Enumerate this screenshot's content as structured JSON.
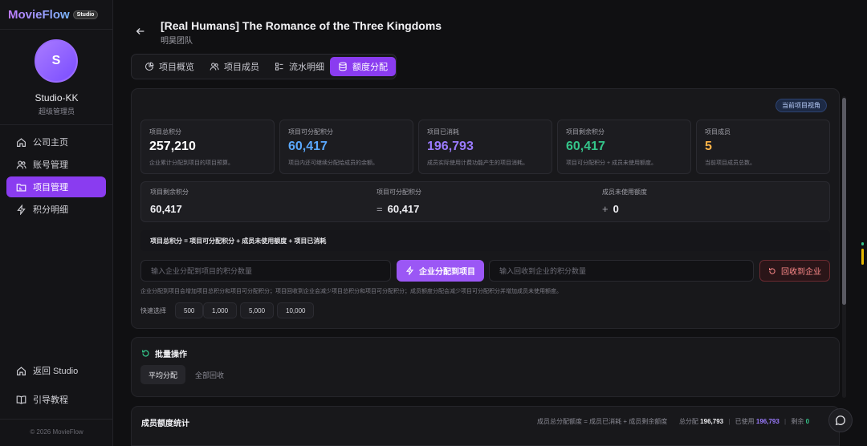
{
  "brand": {
    "name": "MovieFlow",
    "badge": "Studio"
  },
  "user": {
    "initial": "S",
    "name": "Studio-KK",
    "role": "超级管理员"
  },
  "nav": [
    {
      "label": "公司主页",
      "icon": "home-icon"
    },
    {
      "label": "账号管理",
      "icon": "users-icon"
    },
    {
      "label": "项目管理",
      "icon": "folder-icon",
      "active": true
    },
    {
      "label": "积分明细",
      "icon": "lightning-icon"
    }
  ],
  "nav_bottom": [
    {
      "label": "返回 Studio",
      "icon": "home-icon"
    },
    {
      "label": "引导教程",
      "icon": "book-icon"
    }
  ],
  "copyright": "© 2026 MovieFlow",
  "header": {
    "title": "[Real Humans] The Romance of the Three Kingdoms",
    "subtitle": "明昊团队"
  },
  "tabs": [
    {
      "label": "项目概览",
      "icon": "pie-chart-icon"
    },
    {
      "label": "项目成员",
      "icon": "users-icon"
    },
    {
      "label": "流水明细",
      "icon": "list-icon"
    },
    {
      "label": "额度分配",
      "icon": "database-icon",
      "active": true
    }
  ],
  "view_badge": "当前项目视角",
  "cards": [
    {
      "label": "项目总积分",
      "value": "257,210",
      "desc": "企业累计分配到项目的项目预算。",
      "color": "#ffffff"
    },
    {
      "label": "项目可分配积分",
      "value": "60,417",
      "desc": "项目内还可继续分配给成员的余额。",
      "color": "#5aa8ff"
    },
    {
      "label": "项目已消耗",
      "value": "196,793",
      "desc": "成员实际使用计费功能产生的项目消耗。",
      "color": "#9b7bff"
    },
    {
      "label": "项目剩余积分",
      "value": "60,417",
      "desc": "项目可分配积分 + 成员未使用额度。",
      "color": "#34c58a"
    },
    {
      "label": "项目成员",
      "value": "5",
      "desc": "当前项目成员总数。",
      "color": "#ffb347"
    }
  ],
  "formula": {
    "col1": {
      "label": "项目剩余积分",
      "op": "",
      "value": "60,417"
    },
    "col2": {
      "label": "项目可分配积分",
      "op": "=",
      "value": "60,417"
    },
    "col3": {
      "label": "成员未使用额度",
      "op": "+",
      "value": "0"
    }
  },
  "equation": "项目总积分 = 项目可分配积分 + 成员未使用额度 + 项目已消耗",
  "allocate": {
    "input_placeholder": "输入企业分配到项目的积分数量",
    "button": "企业分配到项目",
    "recall_placeholder": "输入回收到企业的积分数量",
    "recall_button": "回收到企业",
    "hint": "企业分配到项目会增加项目总积分和项目可分配积分；项目回收到企业会减少项目总积分和项目可分配积分；成员额度分配会减少项目可分配积分并增加成员未使用额度。"
  },
  "quick": {
    "label": "快速选择",
    "options": [
      "500",
      "1,000",
      "5,000",
      "10,000"
    ]
  },
  "batch": {
    "title": "批量操作",
    "buttons": [
      "平均分配",
      "全部回收"
    ]
  },
  "stats": {
    "title": "成员额度统计",
    "formula": "成员总分配额度 = 成员已消耗 + 成员剩余额度",
    "total_label": "总分配",
    "total_value": "196,793",
    "used_label": "已使用",
    "used_value": "196,793",
    "remaining_label": "剩余",
    "remaining_value": "0"
  }
}
